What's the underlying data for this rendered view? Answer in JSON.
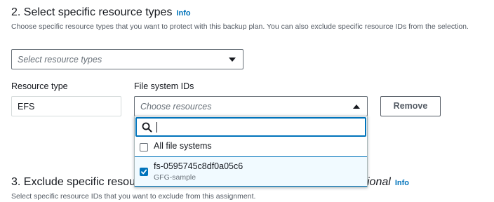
{
  "section2": {
    "title": "2. Select specific resource types",
    "info": "Info",
    "description": "Choose specific resource types that you want to protect with this backup plan. You can also exclude specific resource IDs from the selection.",
    "resource_types_placeholder": "Select resource types"
  },
  "resource_row": {
    "resource_type_label": "Resource type",
    "resource_type_value": "EFS",
    "file_system_ids_label": "File system IDs",
    "choose_placeholder": "Choose resources",
    "remove_button": "Remove"
  },
  "dropdown": {
    "search_value": "",
    "options": [
      {
        "label": "All file systems",
        "checked": false
      },
      {
        "label": "fs-0595745c8df0a05c6",
        "sub": "GFG-sample",
        "checked": true
      }
    ]
  },
  "section3": {
    "title_visible": "3. Exclude specific resou",
    "title_tail": "ional",
    "info": "Info",
    "description": "Select specific resource IDs that you want to exclude from this assignment."
  },
  "colors": {
    "accent": "#0073bb",
    "text": "#16191f",
    "secondary_text": "#545b64",
    "selected_bg": "#f1faff"
  }
}
